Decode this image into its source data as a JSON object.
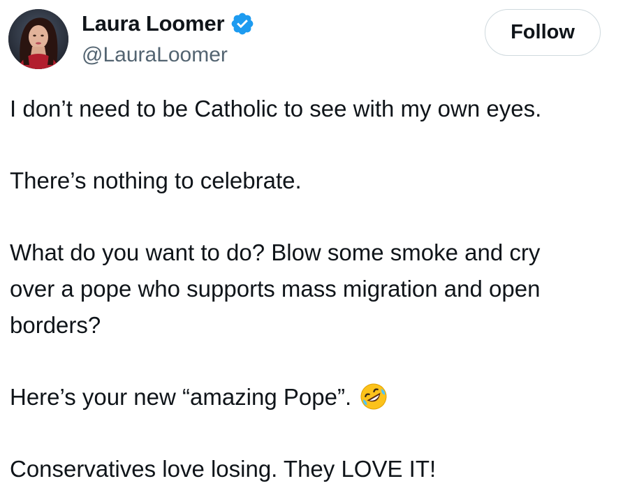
{
  "author": {
    "name": "Laura Loomer",
    "handle": "@LauraLoomer",
    "verified": true,
    "verified_color": "#1d9bf0"
  },
  "follow_button": {
    "label": "Follow"
  },
  "tweet": {
    "lines": [
      "I don’t need to be Catholic to see with my own eyes.",
      "There’s nothing to celebrate.",
      "What do you want to do? Blow some smoke and cry",
      "over a pope who supports mass migration and open",
      "borders?",
      "Here’s your new “amazing Pope”.",
      "Conservatives love losing. They LOVE IT!"
    ],
    "emoji": "rolling-on-the-floor-laughing-icon"
  },
  "colors": {
    "text": "#0f1419",
    "secondary_text": "#536471",
    "border": "#cfd9de"
  }
}
